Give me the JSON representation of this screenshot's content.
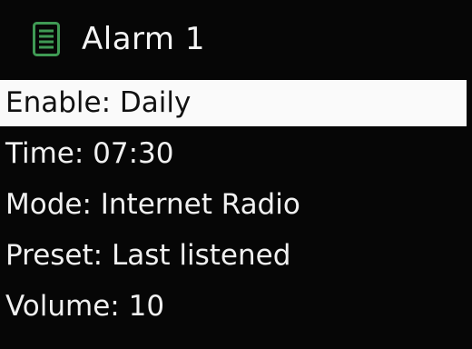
{
  "header": {
    "icon": "list-menu-icon",
    "title": "Alarm 1"
  },
  "menu": {
    "items": [
      {
        "label": "Enable: Daily",
        "selected": true
      },
      {
        "label": "Time: 07:30",
        "selected": false
      },
      {
        "label": "Mode: Internet Radio",
        "selected": false
      },
      {
        "label": "Preset: Last listened",
        "selected": false
      },
      {
        "label": "Volume: 10",
        "selected": false
      }
    ]
  },
  "colors": {
    "background": "#060606",
    "text": "#f0f0f0",
    "highlight": "#fafafa",
    "highlight_text": "#111111",
    "icon_accent": "#3f9a54"
  }
}
